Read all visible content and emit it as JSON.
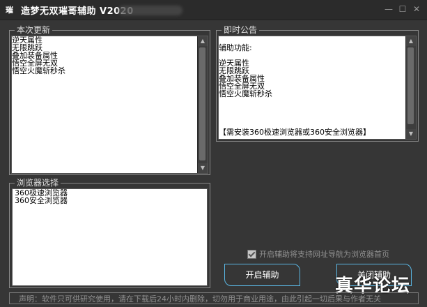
{
  "window": {
    "icon_text": "璀",
    "title": "造梦无双璀哥辅助 V2020",
    "min_icon": "minimize-icon",
    "max_icon": "maximize-icon",
    "close_icon": "close-icon"
  },
  "update_group": {
    "label": "本次更新",
    "items": [
      "逆天属性",
      "无限跳跃",
      "叠加装备属性",
      "悟空全屏无双",
      "悟空火魔斩秒杀"
    ]
  },
  "notice_group": {
    "label": "即时公告",
    "lines": [
      "",
      "辅助功能:",
      "",
      "逆天属性",
      "无限跳跃",
      "叠加装备属性",
      "悟空全屏无双",
      "悟空火魔斩秒杀",
      "",
      "",
      "",
      "",
      "【需安装360极速浏览器或360安全浏览器】"
    ]
  },
  "browser_group": {
    "label": "浏览器选择",
    "options": [
      "360极速浏览器",
      "360安全浏览器"
    ]
  },
  "settings": {
    "checkbox_label": "开启辅助将支持网址导航为浏览器首页",
    "checked": true
  },
  "buttons": {
    "start": "开启辅助",
    "stop": "关闭辅助"
  },
  "footer": {
    "disclaimer": "声明：软件只可供研究使用，请在下载后24小时内删除，切勿用于商业用途，由此引起一切后果与作者无关"
  },
  "watermark": "真华论坛",
  "colors": {
    "background": "#363636",
    "button_border": "#5ab7e4"
  }
}
